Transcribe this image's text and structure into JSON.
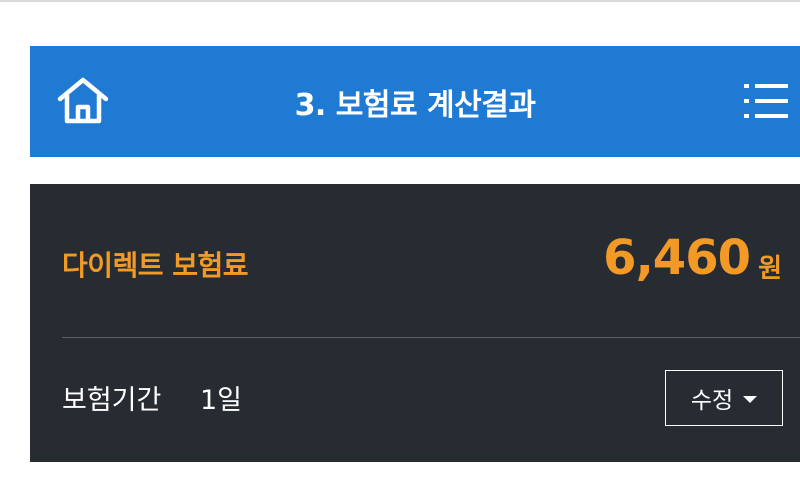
{
  "header": {
    "title": "3. 보험료 계산결과",
    "home_icon": "home-icon",
    "menu_icon": "list-menu-icon",
    "background": "#1f7ad3"
  },
  "premium": {
    "label": "다이렉트 보험료",
    "amount": "6,460",
    "unit": "원",
    "accent_color": "#f29a25"
  },
  "period": {
    "label": "보험기간",
    "value": "1일",
    "edit_label": "수정"
  },
  "panel": {
    "background": "#272b32"
  }
}
